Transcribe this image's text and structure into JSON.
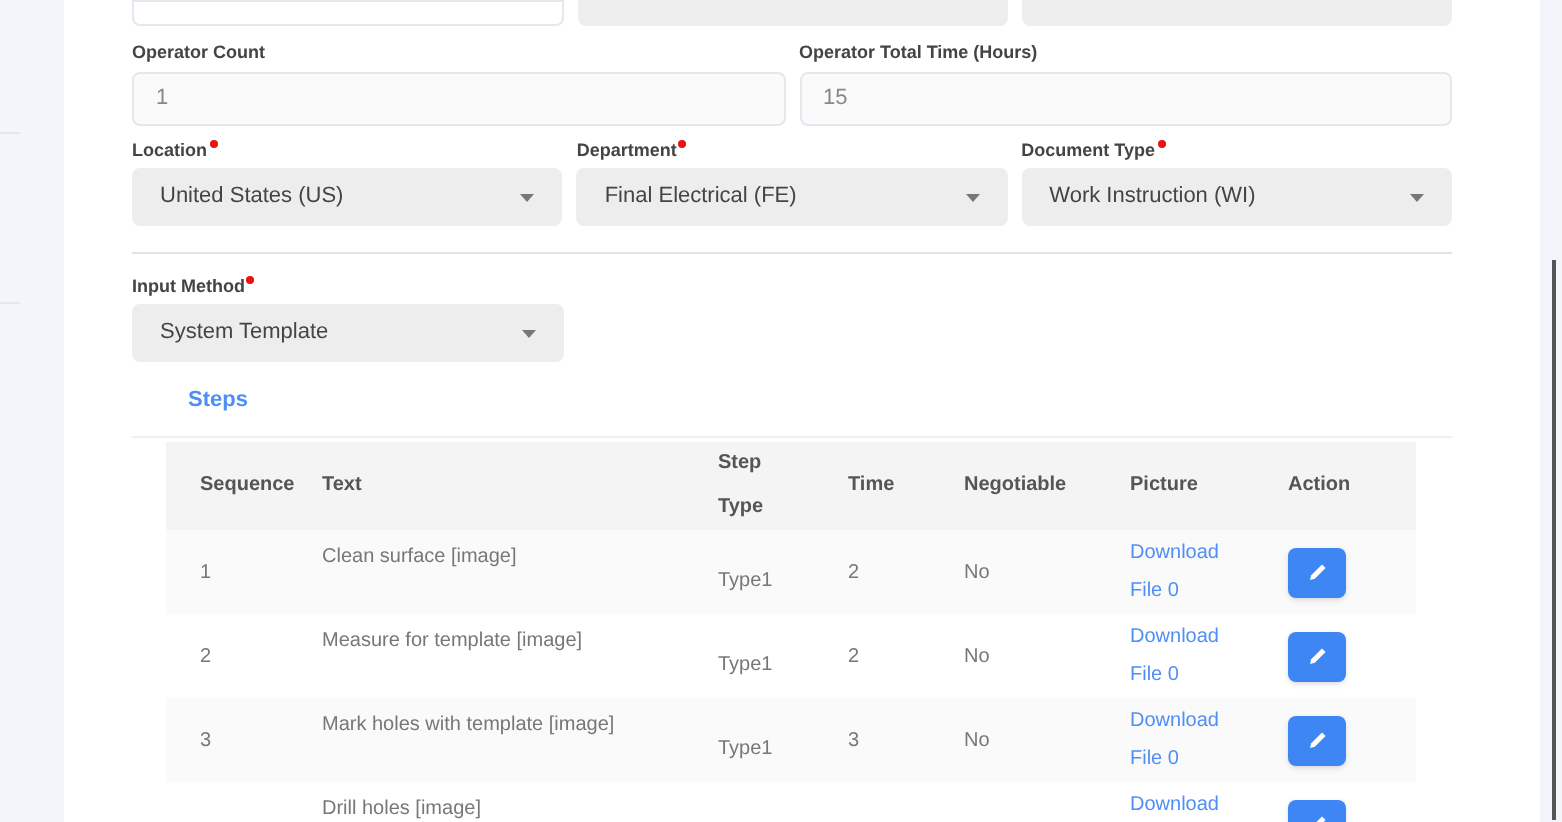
{
  "top_fields": [
    {
      "kind": "textarea"
    },
    {
      "kind": "input"
    },
    {
      "kind": "input"
    }
  ],
  "operator_fields": [
    {
      "label": "Operator Count",
      "value": "1"
    },
    {
      "label": "Operator Total Time (Hours)",
      "value": "15"
    }
  ],
  "selects": [
    {
      "label": "Location",
      "required": true,
      "value": "United States (US)"
    },
    {
      "label": "Department",
      "required": true,
      "value": "Final Electrical (FE)"
    },
    {
      "label": "Document Type",
      "required": true,
      "value": "Work Instruction (WI)"
    }
  ],
  "input_method": {
    "label": "Input Method",
    "required": true,
    "value": "System Template"
  },
  "steps_title": "Steps",
  "table": {
    "columns": [
      "Sequence",
      "Text",
      "Step Type",
      "Time",
      "Negotiable",
      "Picture",
      "Action"
    ],
    "rows": [
      {
        "sequence": "1",
        "text": "Clean surface [image]",
        "step_type": "Type1",
        "time": "2",
        "negotiable": "No",
        "picture": "Download File 0"
      },
      {
        "sequence": "2",
        "text": "Measure for template [image]",
        "step_type": "Type1",
        "time": "2",
        "negotiable": "No",
        "picture": "Download File 0"
      },
      {
        "sequence": "3",
        "text": "Mark holes with template [image]",
        "step_type": "Type1",
        "time": "3",
        "negotiable": "No",
        "picture": "Download File 0"
      },
      {
        "text": "Drill holes [image]",
        "picture": "Download"
      }
    ]
  }
}
